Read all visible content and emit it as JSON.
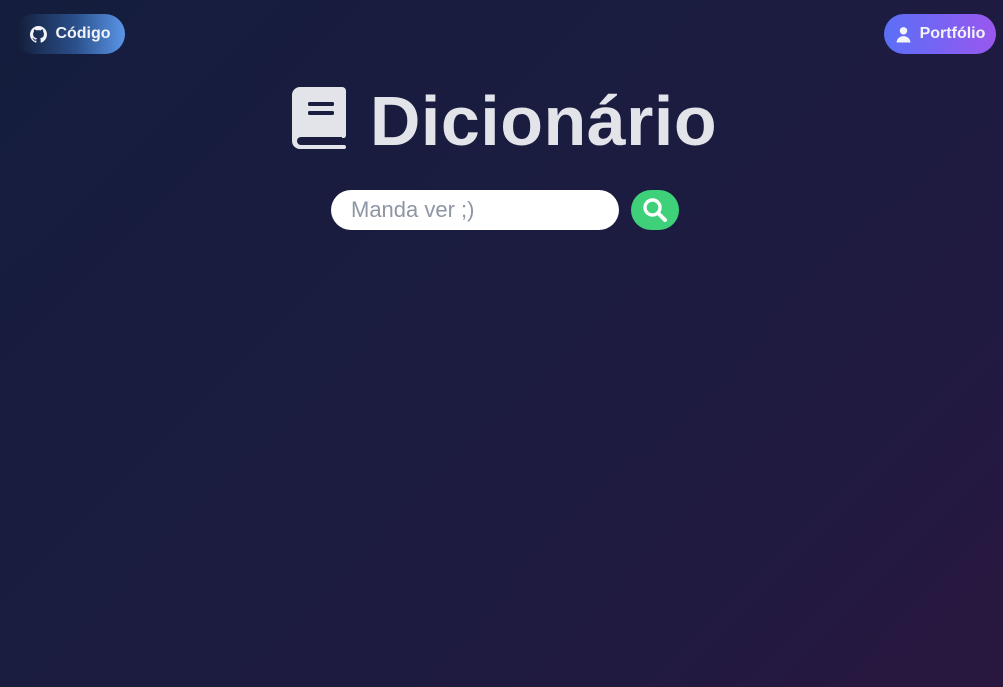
{
  "header": {
    "code_button_label": "Código",
    "code_button_icon": "github-icon",
    "portfolio_button_label": "Portfólio",
    "portfolio_button_icon": "user-icon"
  },
  "main": {
    "title": "Dicionário",
    "title_icon": "book-icon",
    "search": {
      "placeholder": "Manda ver ;)",
      "value": "",
      "button_icon": "search-icon"
    }
  },
  "colors": {
    "background_start": "#141d3d",
    "background_end": "#29173f",
    "title_text": "#e3e3ea",
    "search_button": "#3ed17a",
    "code_button_gradient": [
      "#131b36",
      "#5b95e8"
    ],
    "portfolio_button_gradient": [
      "#5b6ff6",
      "#9a57ee"
    ]
  }
}
